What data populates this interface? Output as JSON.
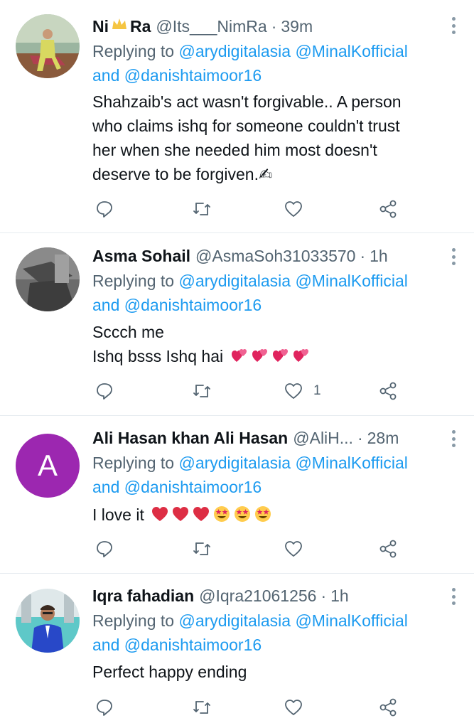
{
  "tweets": [
    {
      "name_prefix": "Ni",
      "name_suffix": "Ra",
      "handle": "@Its___NimRa",
      "time": "39m",
      "replying_to_label": "Replying to",
      "mention_1": "@arydigitalasia",
      "mention_2": "@MinalKofficial",
      "and_label": "and",
      "mention_3": "@danishtaimoor16",
      "text_lines": [
        "Shahzaib's act wasn't forgivable.. A person",
        "who claims ishq for someone couldn't trust",
        "her when she needed him most doesn't",
        "deserve to be forgiven.✍"
      ],
      "like_count": ""
    },
    {
      "name": "Asma Sohail",
      "handle": "@AsmaSoh31033570",
      "time": "1h",
      "replying_to_label": "Replying to",
      "mention_1": "@arydigitalasia",
      "mention_2": "@MinalKofficial",
      "and_label": "and",
      "mention_3": "@danishtaimoor16",
      "text_lines": [
        "Sccch me",
        "Ishq bsss Ishq hai"
      ],
      "like_count": "1"
    },
    {
      "name": "Ali Hasan khan Ali Hasan",
      "handle": "@AliH...",
      "time": "28m",
      "avatar_letter": "A",
      "replying_to_label": "Replying to",
      "mention_1": "@arydigitalasia",
      "mention_2": "@MinalKofficial",
      "and_label": "and",
      "mention_3": "@danishtaimoor16",
      "text_lines": [
        "I love it"
      ],
      "like_count": ""
    },
    {
      "name": "Iqra fahadian",
      "handle": "@Iqra21061256",
      "time": "1h",
      "replying_to_label": "Replying to",
      "mention_1": "@arydigitalasia",
      "mention_2": "@MinalKofficial",
      "and_label": "and",
      "mention_3": "@danishtaimoor16",
      "text_lines": [
        "Perfect happy ending"
      ],
      "like_count": ""
    }
  ],
  "separator": "·",
  "colors": {
    "link": "#1d9bf0",
    "secondary": "#536471",
    "heart": "#e0245e",
    "letter_avatar": "#9c27b0",
    "divider": "#e6ecf0"
  },
  "icons": [
    "reply-icon",
    "retweet-icon",
    "like-icon",
    "share-icon",
    "more-icon",
    "crown-emoji",
    "two-hearts-emoji",
    "red-heart-emoji",
    "star-struck-emoji"
  ]
}
